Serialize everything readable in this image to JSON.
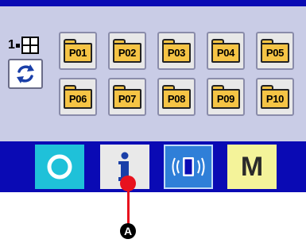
{
  "page_indicator": {
    "page": "1"
  },
  "patterns": [
    {
      "label": "P01"
    },
    {
      "label": "P02"
    },
    {
      "label": "P03"
    },
    {
      "label": "P04"
    },
    {
      "label": "P05"
    },
    {
      "label": "P06"
    },
    {
      "label": "P07"
    },
    {
      "label": "P08"
    },
    {
      "label": "P09"
    },
    {
      "label": "P10"
    }
  ],
  "buttons": {
    "ready": {
      "icon": "ready-ring-icon"
    },
    "info": {
      "icon": "info-icon"
    },
    "communication": {
      "icon": "communication-icon"
    },
    "mode": {
      "label": "M"
    }
  },
  "callout": {
    "label": "A"
  },
  "colors": {
    "frame": "#0a0ab4",
    "screen_background": "#c9cce6",
    "folder": "#f5c445",
    "ready_button": "#1fc1d9",
    "info_button": "#e9e9e9",
    "communication_button": "#2f7fd8",
    "mode_button": "#f4f39a",
    "pointer": "#e8121e"
  }
}
